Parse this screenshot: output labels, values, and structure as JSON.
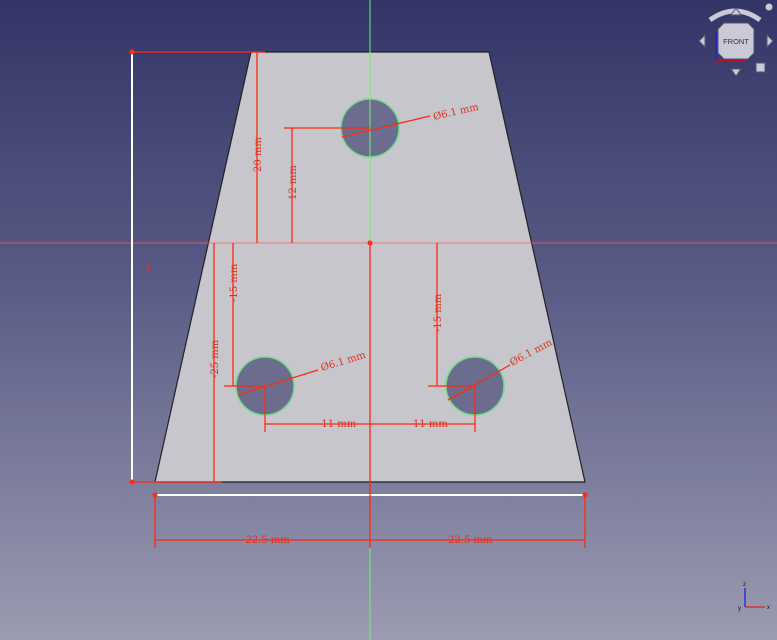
{
  "view": {
    "name": "sketch-view",
    "axis_h_color": "#ff4444",
    "axis_v_color": "#66ff66"
  },
  "navcube": {
    "face_label": "FRONT"
  },
  "dimensions": {
    "top_hole_d": "Ø6.1 mm",
    "left_hole_d": "Ø6.1 mm",
    "right_hole_d": "Ø6.1 mm",
    "height_top": "20 mm",
    "top_hole_y": "12 mm",
    "left_hole_y": "-15 mm",
    "right_hole_y": "-15 mm",
    "height_bottom": "-25 mm",
    "left_hole_x": "-11 mm",
    "right_hole_x": "11 mm",
    "bottom_left": "-22.5 mm",
    "bottom_right": "22.5 mm"
  },
  "axes": {
    "x": "x",
    "y": "y",
    "z": "z"
  }
}
